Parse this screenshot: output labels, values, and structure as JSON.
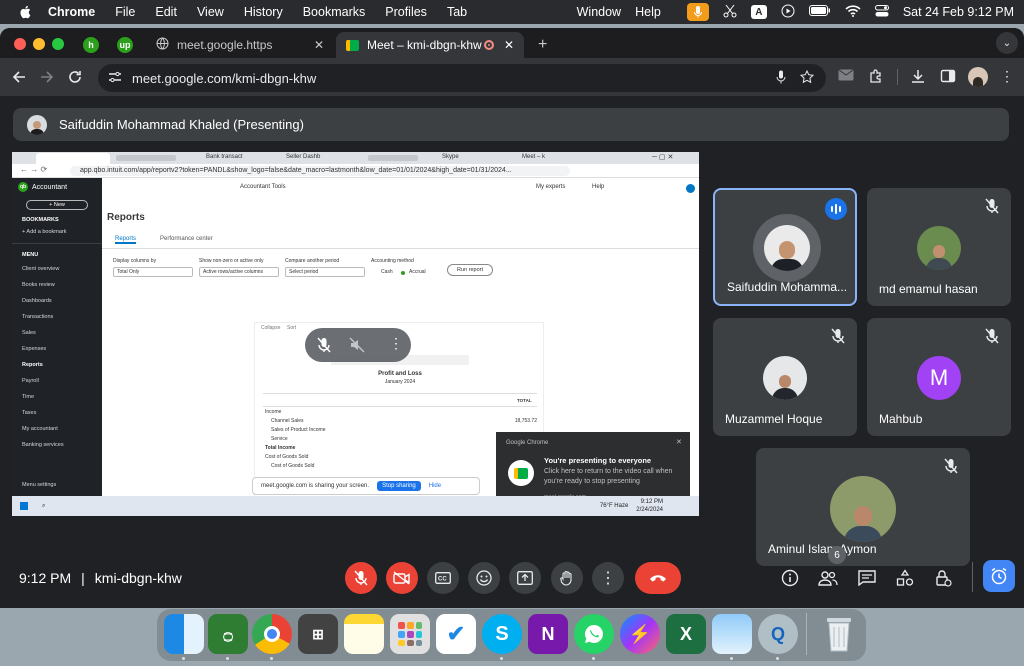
{
  "menubar": {
    "app": "Chrome",
    "items": [
      "File",
      "Edit",
      "View",
      "History",
      "Bookmarks",
      "Profiles",
      "Tab"
    ],
    "right_items": [
      "Window",
      "Help"
    ],
    "datetime": "Sat 24 Feb  9:12 PM"
  },
  "tabs": [
    {
      "label": "meet.google.https"
    },
    {
      "label": "Meet – kmi-dbgn-khw"
    }
  ],
  "address": {
    "url": "meet.google.com/kmi-dbgn-khw"
  },
  "presenter": {
    "label": "Saifuddin Mohammad Khaled (Presenting)"
  },
  "participants": [
    {
      "name": "Saifuddin Mohamma...",
      "speaking": true
    },
    {
      "name": "md emamul hasan",
      "muted": true
    },
    {
      "name": "Muzammel Hoque",
      "muted": true
    },
    {
      "name": "Mahbub",
      "initial": "M",
      "avatar_color": "#a142f4",
      "muted": true
    },
    {
      "name": "Aminul Islam Aymon",
      "muted": true
    }
  ],
  "shared_screen": {
    "url": "app.qbo.intuit.com/app/reportv2?token=PANDL&show_logo=false&date_macro=lastmonth&low_date=01/01/2024&high_date=01/31/2024...",
    "inner_tabs": [
      "Bank transact",
      "Seller Dashb",
      "Skype",
      "Meet – k"
    ],
    "sidebar": {
      "brand": "Accountant",
      "new_button": "+ New",
      "bookmarks_header": "BOOKMARKS",
      "add_bookmark": "+ Add a bookmark",
      "menu_header": "MENU",
      "items": [
        "Client overview",
        "Books review",
        "Dashboards",
        "Transactions",
        "Sales",
        "Expenses",
        "Reports",
        "Payroll",
        "Time",
        "Taxes",
        "My accountant",
        "Banking services"
      ],
      "active": "Reports",
      "footer": "Menu settings"
    },
    "top": {
      "accountant_tools": "Accountant Tools",
      "my_experts": "My experts",
      "help": "Help"
    },
    "page_title": "Reports",
    "subtabs": [
      "Reports",
      "Performance center"
    ],
    "filters": [
      {
        "label": "Display columns by",
        "value": "Total Only"
      },
      {
        "label": "Show non-zero or active only",
        "value": "Active rows/active columns"
      },
      {
        "label": "Compare another period",
        "value": "Select period"
      },
      {
        "label": "Accounting method",
        "value": ""
      }
    ],
    "method_options": [
      "Cash",
      "Accrual"
    ],
    "run_report": "Run report",
    "report_toolbar": [
      "Collapse",
      "Sort"
    ],
    "report": {
      "title": "Profit and Loss",
      "period": "January 2024",
      "total_header": "TOTAL",
      "rows": [
        {
          "label": "Income",
          "value": "",
          "indent": 0
        },
        {
          "label": "Channel Sales",
          "value": "18,753.72",
          "indent": 1
        },
        {
          "label": "Sales of Product Income",
          "value": "",
          "indent": 1
        },
        {
          "label": "Service",
          "value": "",
          "indent": 1
        },
        {
          "label": "Total Income",
          "value": "",
          "indent": 0
        },
        {
          "label": "Cost of Goods Sold",
          "value": "",
          "indent": 0
        },
        {
          "label": "Cost of Goods Sold",
          "value": "",
          "indent": 1
        }
      ]
    },
    "sharing_bar": {
      "text": "meet.google.com is sharing your screen.",
      "stop": "Stop sharing",
      "hide": "Hide"
    },
    "notification": {
      "app": "Google Chrome",
      "title": "You're presenting to everyone",
      "body": "Click here to return to the video call when you're ready to stop presenting",
      "source": "meet.google.com"
    },
    "taskbar": {
      "weather": "76°F  Haze",
      "time": "9:12 PM",
      "date": "2/24/2024"
    }
  },
  "bottom": {
    "time": "9:12 PM",
    "separator": "|",
    "meeting_code": "kmi-dbgn-khw",
    "participant_count": "6"
  },
  "dock": [
    "Finder",
    "Quran",
    "Chrome",
    "Calculator",
    "Notes",
    "Launchpad",
    "Tasks",
    "Skype",
    "OneNote",
    "WhatsApp",
    "Messenger",
    "Excel",
    "Preview",
    "QuickTime",
    "Trash"
  ]
}
